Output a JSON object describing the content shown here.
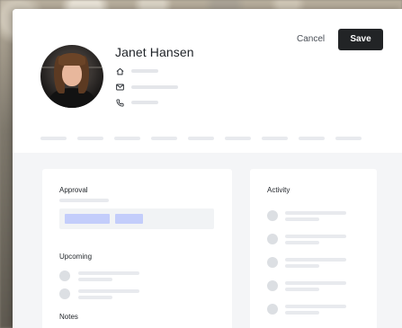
{
  "profile": {
    "name": "Janet Hansen",
    "avatar_icon": "avatar-photo",
    "info_icons": [
      "home-icon",
      "mail-icon",
      "phone-icon"
    ]
  },
  "actions": {
    "cancel_label": "Cancel",
    "save_label": "Save"
  },
  "cards": {
    "approval_title": "Approval",
    "upcoming_title": "Upcoming",
    "notes_title": "Notes",
    "activity_title": "Activity"
  },
  "colors": {
    "accent_chip": "#c3cdfb",
    "save_button": "#222426",
    "panel_bg": "#f4f5f7"
  }
}
